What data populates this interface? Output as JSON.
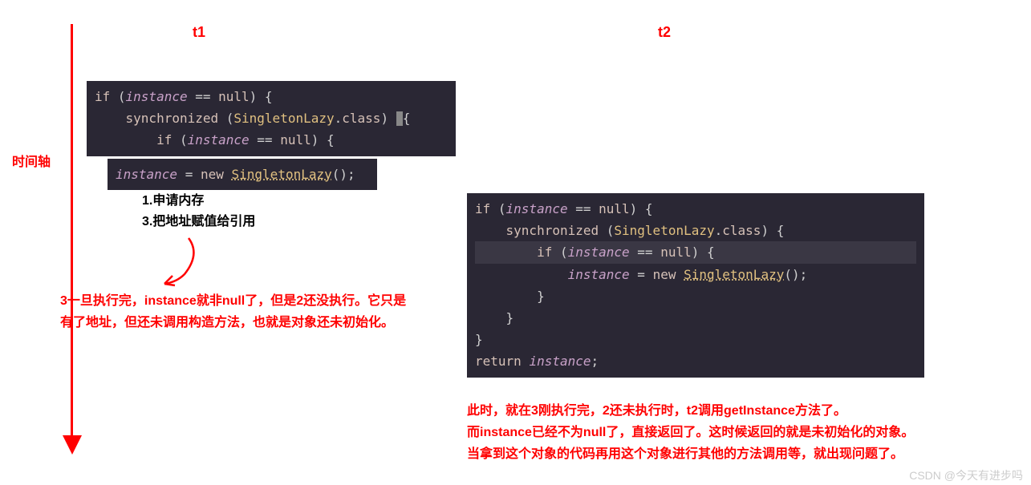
{
  "labels": {
    "timeline": "时间轴",
    "t1": "t1",
    "t2": "t2"
  },
  "notes": {
    "step1": "1.申请内存",
    "step3": "3.把地址赋值给引用",
    "red1_line1": "3一旦执行完，instance就非null了，但是2还没执行。它只是",
    "red1_line2": "有了地址，但还未调用构造方法，也就是对象还未初始化。",
    "red2_line1": "此时，就在3刚执行完，2还未执行时，t2调用getInstance方法了。",
    "red2_line2": "而instance已经不为null了，直接返回了。这时候返回的就是未初始化的对象。",
    "red2_line3": "当拿到这个对象的代码再用这个对象进行其他的方法调用等，就出现问题了。"
  },
  "code": {
    "c1_l1_kw1": "if",
    "c1_l1_ident1": "instance",
    "c1_l1_kw2": "null",
    "c1_l2_kw1": "synchronized",
    "c1_l2_cls1": "SingletonLazy",
    "c1_l2_kw2": "class",
    "c1_l3_kw1": "if",
    "c1_l3_ident1": "instance",
    "c1_l3_kw2": "null",
    "c2_ident1": "instance",
    "c2_kw1": "new",
    "c2_cls1": "SingletonLazy",
    "c3_l1_kw1": "if",
    "c3_l1_ident1": "instance",
    "c3_l1_kw2": "null",
    "c3_l2_kw1": "synchronized",
    "c3_l2_cls1": "SingletonLazy",
    "c3_l2_kw2": "class",
    "c3_l3_kw1": "if",
    "c3_l3_ident1": "instance",
    "c3_l3_kw2": "null",
    "c3_l4_ident1": "instance",
    "c3_l4_kw1": "new",
    "c3_l4_cls1": "SingletonLazy",
    "c3_l8_kw1": "return",
    "c3_l8_ident1": "instance"
  },
  "watermark": "CSDN @今天有进步吗"
}
